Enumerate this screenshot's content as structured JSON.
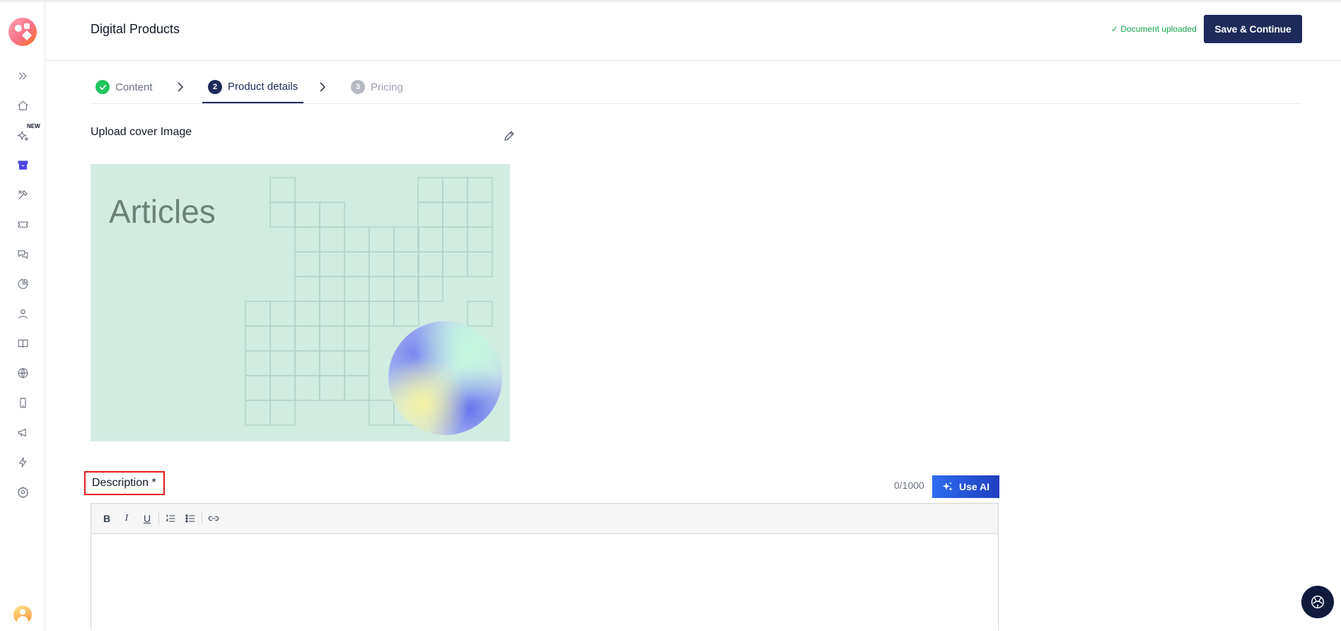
{
  "header": {
    "title": "Digital Products",
    "status": "✓ Document uploaded",
    "save_label": "Save & Continue"
  },
  "sidebar": {
    "new_badge": "NEW",
    "items": [
      {
        "icon": "expand-icon"
      },
      {
        "icon": "home-icon"
      },
      {
        "icon": "sparkle-icon"
      },
      {
        "icon": "archive-icon",
        "active": true
      },
      {
        "icon": "tools-icon"
      },
      {
        "icon": "ticket-icon"
      },
      {
        "icon": "chat-icon"
      },
      {
        "icon": "pie-chart-icon"
      },
      {
        "icon": "user-icon"
      },
      {
        "icon": "book-icon"
      },
      {
        "icon": "globe-icon"
      },
      {
        "icon": "mobile-icon"
      },
      {
        "icon": "megaphone-icon"
      },
      {
        "icon": "lightning-icon"
      },
      {
        "icon": "settings-icon"
      }
    ]
  },
  "steps": [
    {
      "label": "Content",
      "state": "done"
    },
    {
      "number": "2",
      "label": "Product details",
      "state": "active"
    },
    {
      "number": "3",
      "label": "Pricing",
      "state": "upcoming"
    }
  ],
  "cover": {
    "label": "Upload cover Image",
    "image_text": "Articles"
  },
  "description": {
    "label": "Description *",
    "counter": "0/1000",
    "ai_label": "Use AI"
  },
  "toolbar": {
    "bold": "B",
    "italic": "I",
    "underline": "U"
  },
  "colors": {
    "primary": "#1e2a5a",
    "success": "#22c55e",
    "highlight": "#e11d1d",
    "cover_bg": "#d3ece2"
  }
}
